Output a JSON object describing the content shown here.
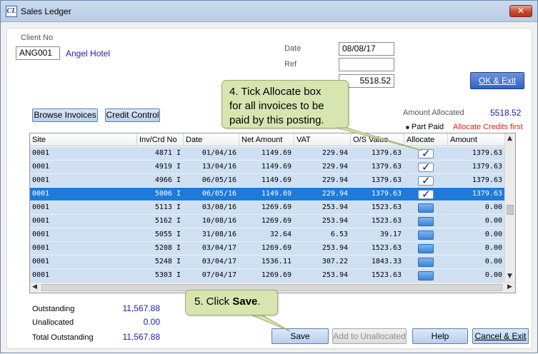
{
  "window": {
    "title": "Sales Ledger",
    "app_icon": "CL",
    "close_icon": "close-icon"
  },
  "client": {
    "label": "Client No",
    "value": "ANG001",
    "name": "Angel Hotel"
  },
  "posting": {
    "date_label": "Date",
    "date_value": "08/08/17",
    "ref_label": "Ref",
    "ref_value": "",
    "amount_value": "5518.52"
  },
  "buttons": {
    "ok_exit": "OK & Exit",
    "browse_invoices": "Browse Invoices",
    "credit_control": "Credit Control",
    "save": "Save",
    "add_to_unallocated": "Add to Unallocated",
    "help": "Help",
    "cancel_exit": "Cancel & Exit"
  },
  "allocation": {
    "amount_allocated_label": "Amount Allocated",
    "amount_allocated_value": "5518.52",
    "part_paid_label": "Part Paid",
    "allocate_credits_first": "Allocate Credits first"
  },
  "table": {
    "columns": [
      "Site",
      "Inv/Crd No",
      "Date",
      "Net Amount",
      "VAT",
      "O/S Value",
      "Allocate",
      "Amount"
    ],
    "rows": [
      {
        "site": "0001",
        "inv": "4871 I",
        "date": "01/04/16",
        "net": "1149.69",
        "vat": "229.94",
        "os": "1379.63",
        "allocate": true,
        "amount": "1379.63"
      },
      {
        "site": "0001",
        "inv": "4919 I",
        "date": "13/04/16",
        "net": "1149.69",
        "vat": "229.94",
        "os": "1379.63",
        "allocate": true,
        "amount": "1379.63"
      },
      {
        "site": "0001",
        "inv": "4966 I",
        "date": "06/05/16",
        "net": "1149.69",
        "vat": "229.94",
        "os": "1379.63",
        "allocate": true,
        "amount": "1379.63"
      },
      {
        "site": "0001",
        "inv": "5006 I",
        "date": "06/05/16",
        "net": "1149.69",
        "vat": "229.94",
        "os": "1379.63",
        "allocate": true,
        "amount": "1379.63",
        "selected": true
      },
      {
        "site": "0001",
        "inv": "5113 I",
        "date": "03/08/16",
        "net": "1269.69",
        "vat": "253.94",
        "os": "1523.63",
        "allocate": false,
        "amount": "0.00"
      },
      {
        "site": "0001",
        "inv": "5162 I",
        "date": "10/08/16",
        "net": "1269.69",
        "vat": "253.94",
        "os": "1523.63",
        "allocate": false,
        "amount": "0.00"
      },
      {
        "site": "0001",
        "inv": "5055 I",
        "date": "31/08/16",
        "net": "32.64",
        "vat": "6.53",
        "os": "39.17",
        "allocate": false,
        "amount": "0.00"
      },
      {
        "site": "0001",
        "inv": "5208 I",
        "date": "03/04/17",
        "net": "1269.69",
        "vat": "253.94",
        "os": "1523.63",
        "allocate": false,
        "amount": "0.00"
      },
      {
        "site": "0001",
        "inv": "5248 I",
        "date": "03/04/17",
        "net": "1536.11",
        "vat": "307.22",
        "os": "1843.33",
        "allocate": false,
        "amount": "0.00"
      },
      {
        "site": "0001",
        "inv": "5303 I",
        "date": "07/04/17",
        "net": "1269.69",
        "vat": "253.94",
        "os": "1523.63",
        "allocate": false,
        "amount": "0.00"
      }
    ]
  },
  "totals": {
    "outstanding_label": "Outstanding",
    "outstanding_value": "11,567.88",
    "unallocated_label": "Unallocated",
    "unallocated_value": "0.00",
    "total_outstanding_label": "Total Outstanding",
    "total_outstanding_value": "11,567.88"
  },
  "callouts": {
    "step4_line1": "4. Tick Allocate box",
    "step4_line2": "for all invoices to be",
    "step4_line3": "paid by this posting.",
    "step5_prefix": "5. Click ",
    "step5_bold": "Save",
    "step5_suffix": "."
  },
  "colors": {
    "selected_row": "#1f7ad9",
    "row_background": "#cfe0f3",
    "link_blue": "#1a1ab8",
    "warning_red": "#e0201b",
    "callout_green": "#d7e6b1"
  }
}
